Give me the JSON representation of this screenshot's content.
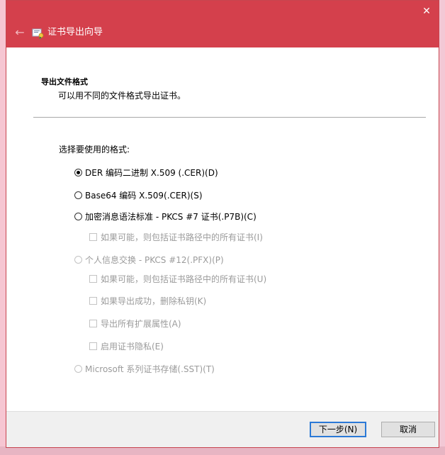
{
  "window": {
    "title": "证书导出向导",
    "close_label": "✕",
    "back_label": "←"
  },
  "page": {
    "section_title": "导出文件格式",
    "section_description": "可以用不同的文件格式导出证书。",
    "prompt": "选择要使用的格式:"
  },
  "options": {
    "der": "DER 编码二进制 X.509 (.CER)(D)",
    "base64": "Base64 编码 X.509(.CER)(S)",
    "pkcs7": "加密消息语法标准 - PKCS #7 证书(.P7B)(C)",
    "pkcs7_include_all": "如果可能，则包括证书路径中的所有证书(I)",
    "pfx": "个人信息交换 - PKCS #12(.PFX)(P)",
    "pfx_include_all": "如果可能，则包括证书路径中的所有证书(U)",
    "pfx_delete_key": "如果导出成功，删除私钥(K)",
    "pfx_export_ext": "导出所有扩展属性(A)",
    "pfx_enable_privacy": "启用证书隐私(E)",
    "sst": "Microsoft 系列证书存储(.SST)(T)"
  },
  "buttons": {
    "next": "下一步(N)",
    "cancel": "取消"
  },
  "colors": {
    "titlebar": "#d4404c",
    "accent": "#2b79d6"
  }
}
